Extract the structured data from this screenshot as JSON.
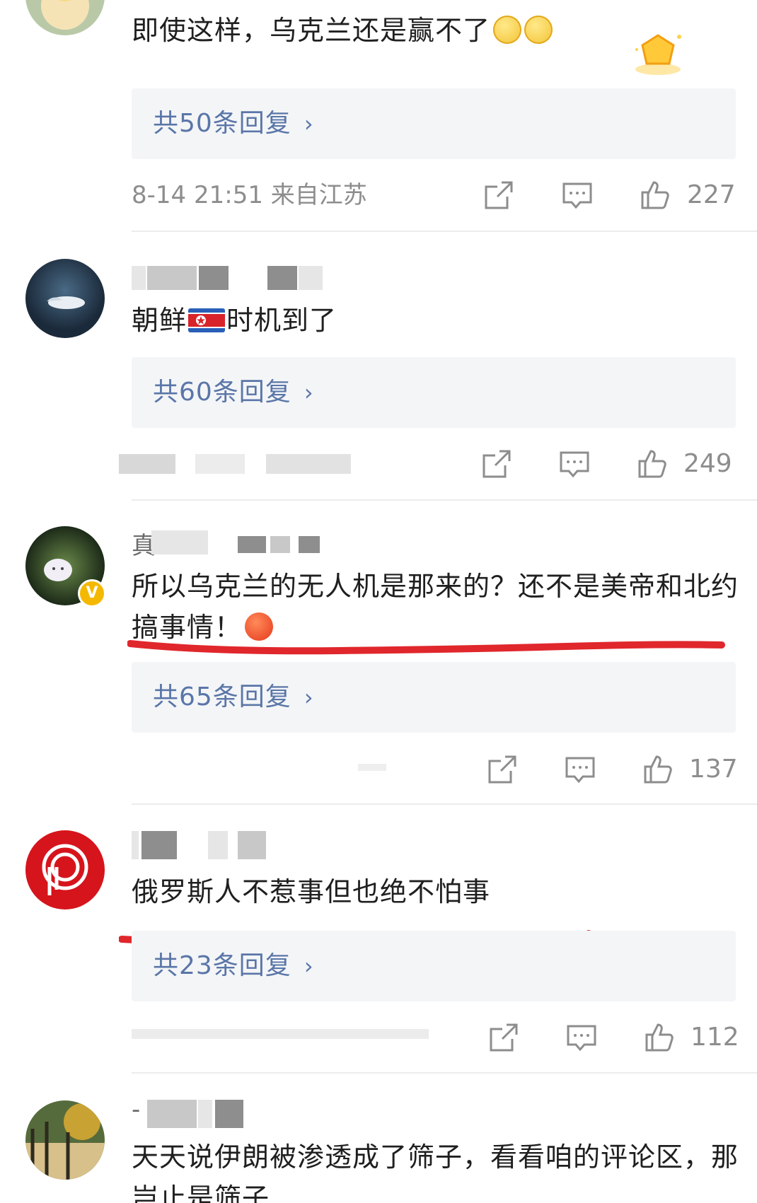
{
  "comments": [
    {
      "text": "即使这样，乌克兰还是赢不了",
      "reply_label": "共50条回复",
      "time": "8-14 21:51",
      "location": "来自江苏",
      "likes": "227"
    },
    {
      "text_a": "朝鲜",
      "text_b": "时机到了",
      "reply_label": "共60条回复",
      "likes": "249"
    },
    {
      "username_first_char": "真",
      "text": "所以乌克兰的无人机是那来的？还不是美帝和北约搞事情！",
      "reply_label": "共65条回复",
      "likes": "137"
    },
    {
      "text": "俄罗斯人不惹事但也绝不怕事",
      "reply_label": "共23条回复",
      "likes": "112"
    },
    {
      "username_first_char": "-",
      "text": "天天说伊朗被渗透成了筛子，看看咱的评论区，那岂止是筛子"
    }
  ],
  "colors": {
    "reply_link": "#5a76a8",
    "meta_text": "#8d8d8d",
    "underline": "#e0272c",
    "verified_badge": "#f5b800"
  },
  "icons": {
    "actions": [
      "share-icon",
      "comment-icon",
      "like-icon"
    ],
    "chevron": "chevron-right-icon"
  }
}
